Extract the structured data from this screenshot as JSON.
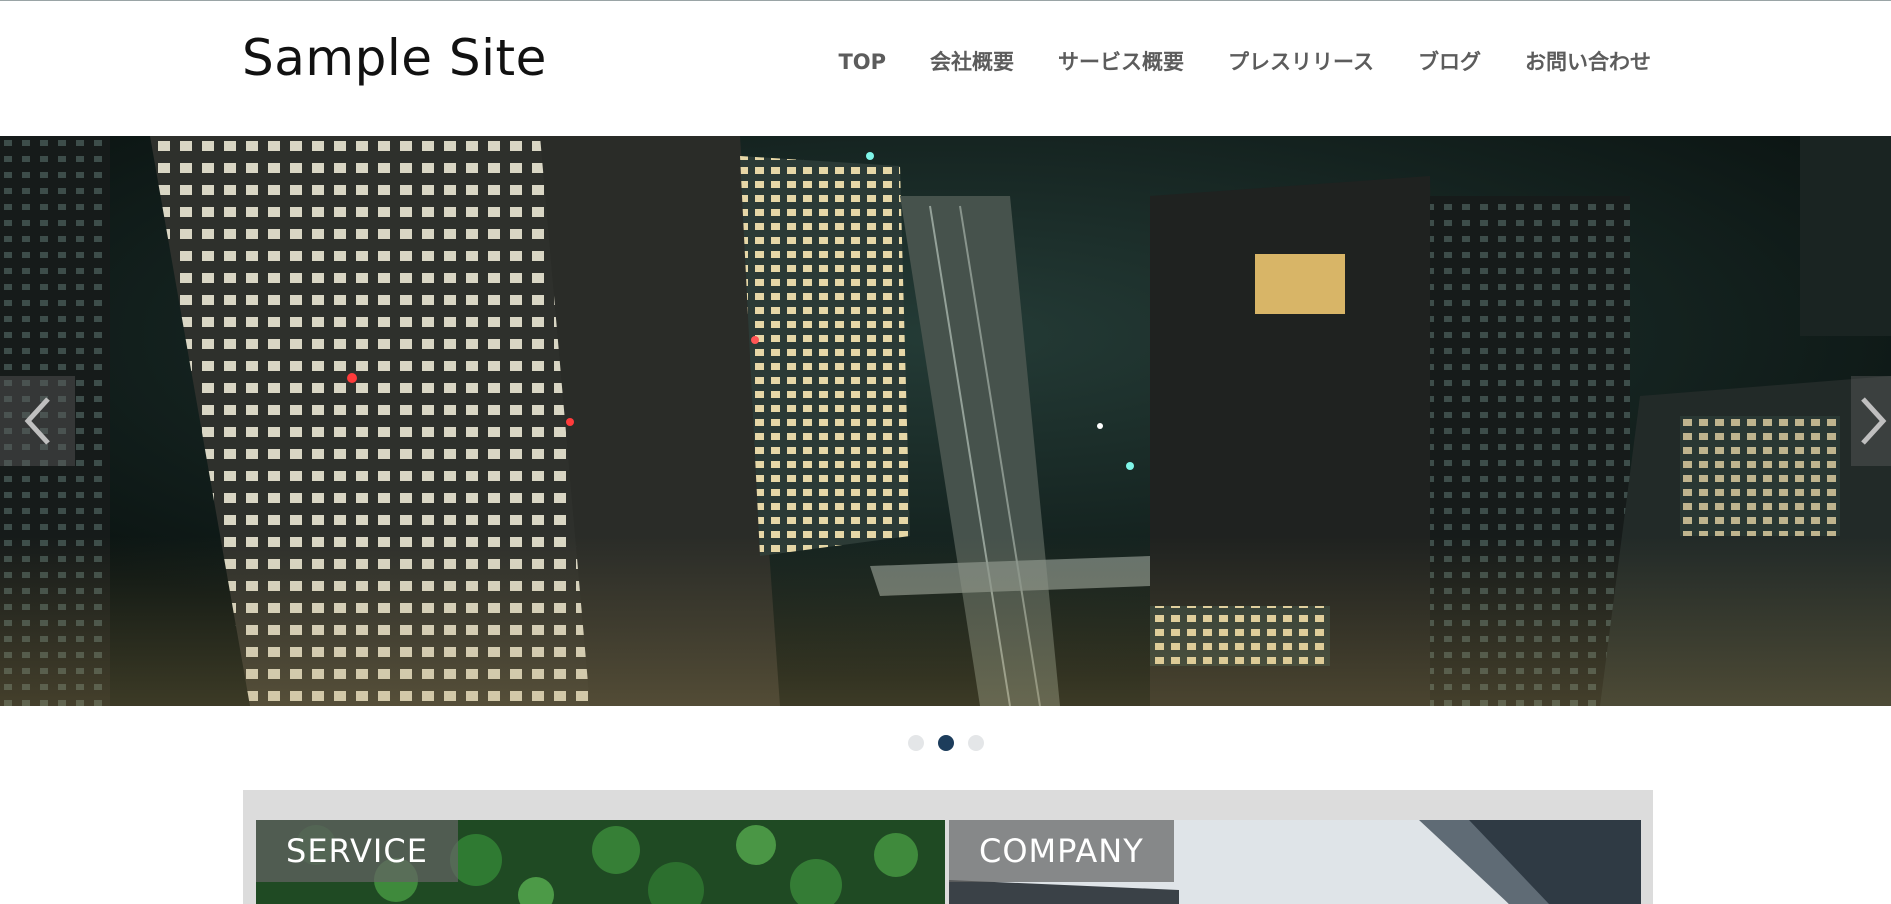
{
  "site": {
    "title": "Sample Site"
  },
  "nav": {
    "items": [
      "TOP",
      "会社概要",
      "サービス概要",
      "プレスリリース",
      "ブログ",
      "お問い合わせ"
    ]
  },
  "slider": {
    "prev_icon": "chevron-left-icon",
    "next_icon": "chevron-right-icon",
    "slide_count": 3,
    "active_index": 1
  },
  "panels": {
    "service": {
      "label": "SERVICE"
    },
    "company": {
      "label": "COMPANY"
    }
  },
  "colors": {
    "nav_text": "#5c5c5c",
    "active_dot": "#1d3d5c",
    "inactive_dot": "#e4e6e8",
    "panel_bg": "#dcdcdc"
  }
}
